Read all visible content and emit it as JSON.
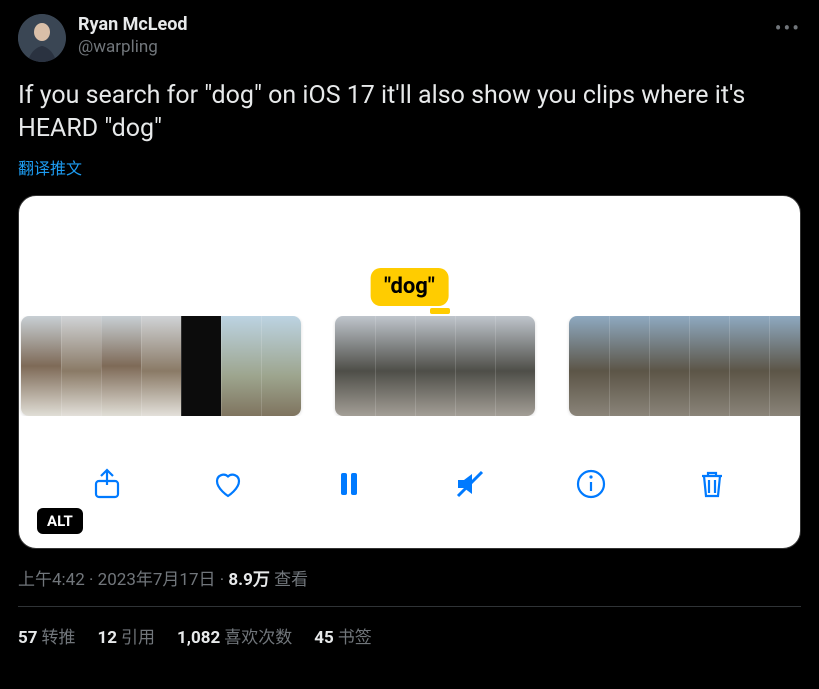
{
  "author": {
    "display_name": "Ryan McLeod",
    "handle": "@warpling"
  },
  "tweet_text": "If you search for \"dog\" on iOS 17 it'll also show you clips where it's HEARD \"dog\"",
  "translate_label": "翻译推文",
  "media": {
    "search_term": "\"dog\"",
    "alt_badge": "ALT"
  },
  "timestamp": {
    "time": "上午4:42",
    "date": "2023年7月17日",
    "views_count": "8.9万",
    "views_label": "查看"
  },
  "stats": {
    "retweets": {
      "count": "57",
      "label": "转推"
    },
    "quotes": {
      "count": "12",
      "label": "引用"
    },
    "likes": {
      "count": "1,082",
      "label": "喜欢次数"
    },
    "bookmarks": {
      "count": "45",
      "label": "书签"
    }
  }
}
